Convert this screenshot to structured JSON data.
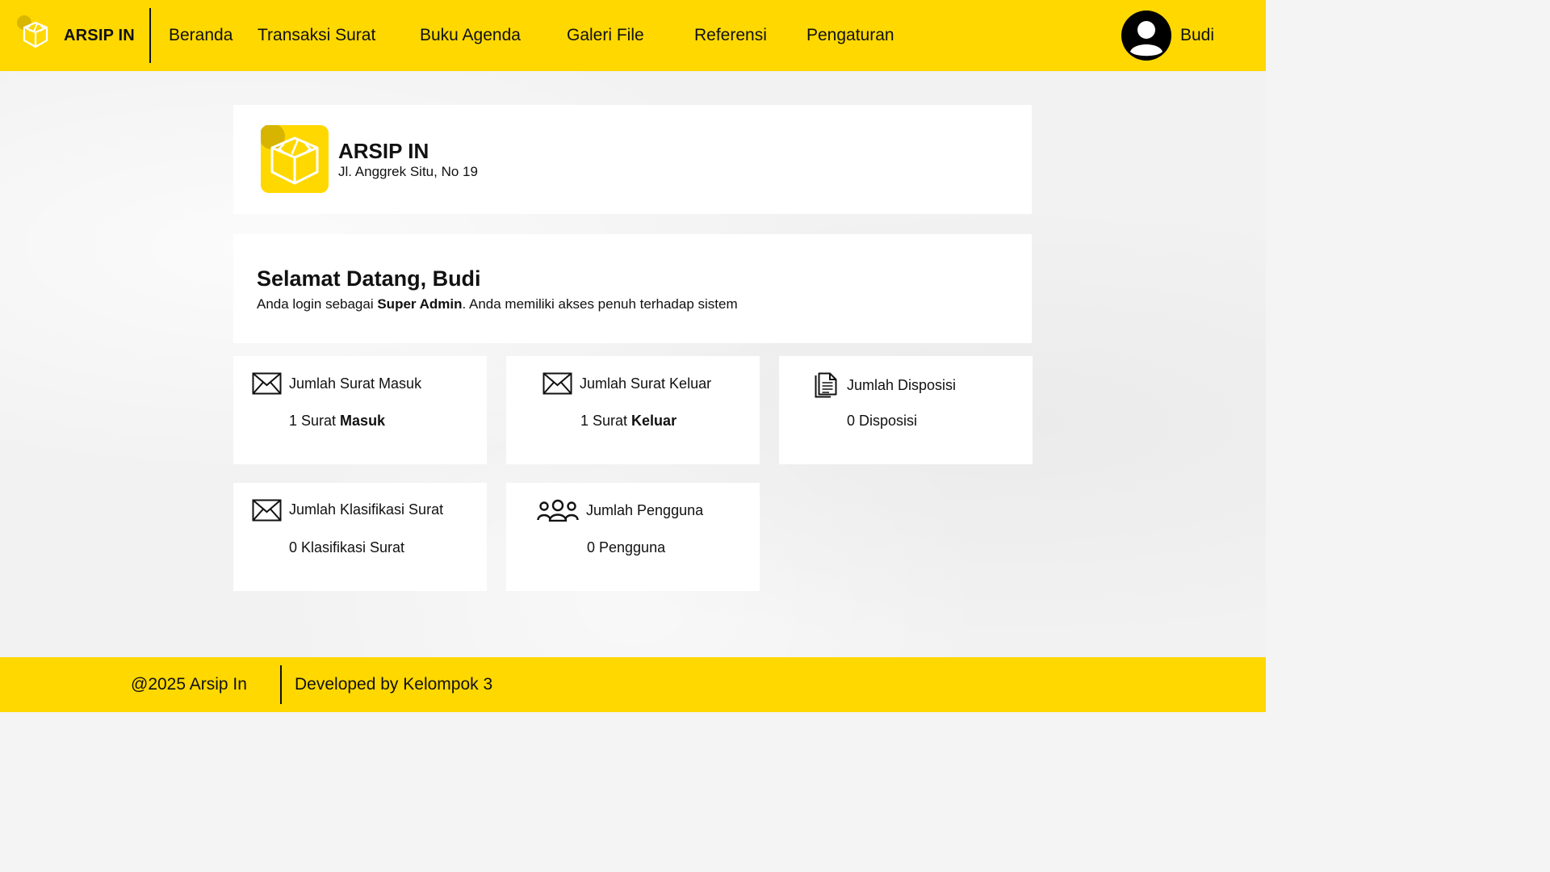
{
  "header": {
    "brand": "ARSIP IN",
    "nav": [
      {
        "label": "Beranda"
      },
      {
        "label": "Transaksi Surat"
      },
      {
        "label": "Buku Agenda"
      },
      {
        "label": "Galeri File"
      },
      {
        "label": "Referensi"
      },
      {
        "label": "Pengaturan"
      }
    ],
    "user_name": "Budi",
    "avatar_icon": "user-circle-icon"
  },
  "org": {
    "name": "ARSIP IN",
    "address": "Jl. Anggrek Situ, No 19"
  },
  "welcome": {
    "title": "Selamat Datang, Budi",
    "sub_prefix": "Anda login sebagai ",
    "role": "Super Admin",
    "sub_suffix": ". Anda memiliki akses penuh terhadap sistem"
  },
  "stats": [
    {
      "icon": "envelope-icon",
      "label": "Jumlah Surat Masuk",
      "value_prefix": "1 Surat ",
      "value_bold": "Masuk"
    },
    {
      "icon": "envelope-icon",
      "label": "Jumlah Surat Keluar",
      "value_prefix": "1 Surat ",
      "value_bold": "Keluar"
    },
    {
      "icon": "document-icon",
      "label": "Jumlah Disposisi",
      "value_prefix": "0 Disposisi",
      "value_bold": ""
    },
    {
      "icon": "envelope-icon",
      "label": "Jumlah Klasifikasi Surat",
      "value_prefix": "0 Klasifikasi Surat",
      "value_bold": ""
    },
    {
      "icon": "users-group-icon",
      "label": "Jumlah Pengguna",
      "value_prefix": "0 Pengguna",
      "value_bold": ""
    }
  ],
  "footer": {
    "copyright": "@2025 Arsip In",
    "developer": "Developed by Kelompok 3"
  },
  "colors": {
    "accent": "#ffd800",
    "text": "#111111",
    "card": "#ffffff"
  }
}
